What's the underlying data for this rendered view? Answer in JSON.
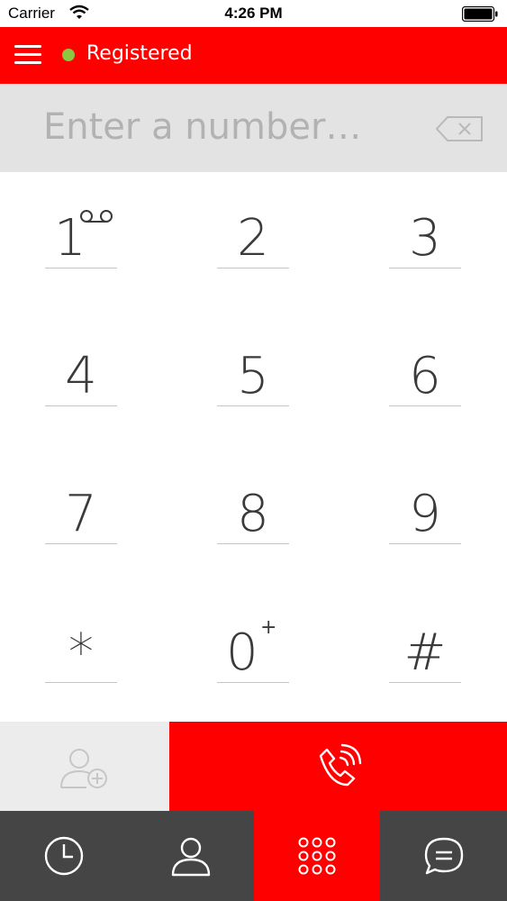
{
  "status_bar": {
    "carrier": "Carrier",
    "time": "4:26 PM"
  },
  "header": {
    "status_label": "Registered",
    "status_color": "#8dc63f",
    "accent": "#ff0000"
  },
  "number_entry": {
    "placeholder": "Enter a number…",
    "value": ""
  },
  "keypad": {
    "k1": {
      "digit": "1",
      "sub_icon": "voicemail-icon"
    },
    "k2": {
      "digit": "2"
    },
    "k3": {
      "digit": "3"
    },
    "k4": {
      "digit": "4"
    },
    "k5": {
      "digit": "5"
    },
    "k6": {
      "digit": "6"
    },
    "k7": {
      "digit": "7"
    },
    "k8": {
      "digit": "8"
    },
    "k9": {
      "digit": "9"
    },
    "kstar": {
      "digit": "*"
    },
    "k0": {
      "digit": "0",
      "sub": "+"
    },
    "khash": {
      "digit": "#"
    }
  },
  "actions": {
    "add_contact_icon": "add-contact-icon",
    "call_icon": "phone-call-icon"
  },
  "tabs": [
    {
      "icon": "clock-icon",
      "active": false
    },
    {
      "icon": "person-icon",
      "active": false
    },
    {
      "icon": "dialpad-icon",
      "active": true
    },
    {
      "icon": "chat-icon",
      "active": false
    }
  ]
}
